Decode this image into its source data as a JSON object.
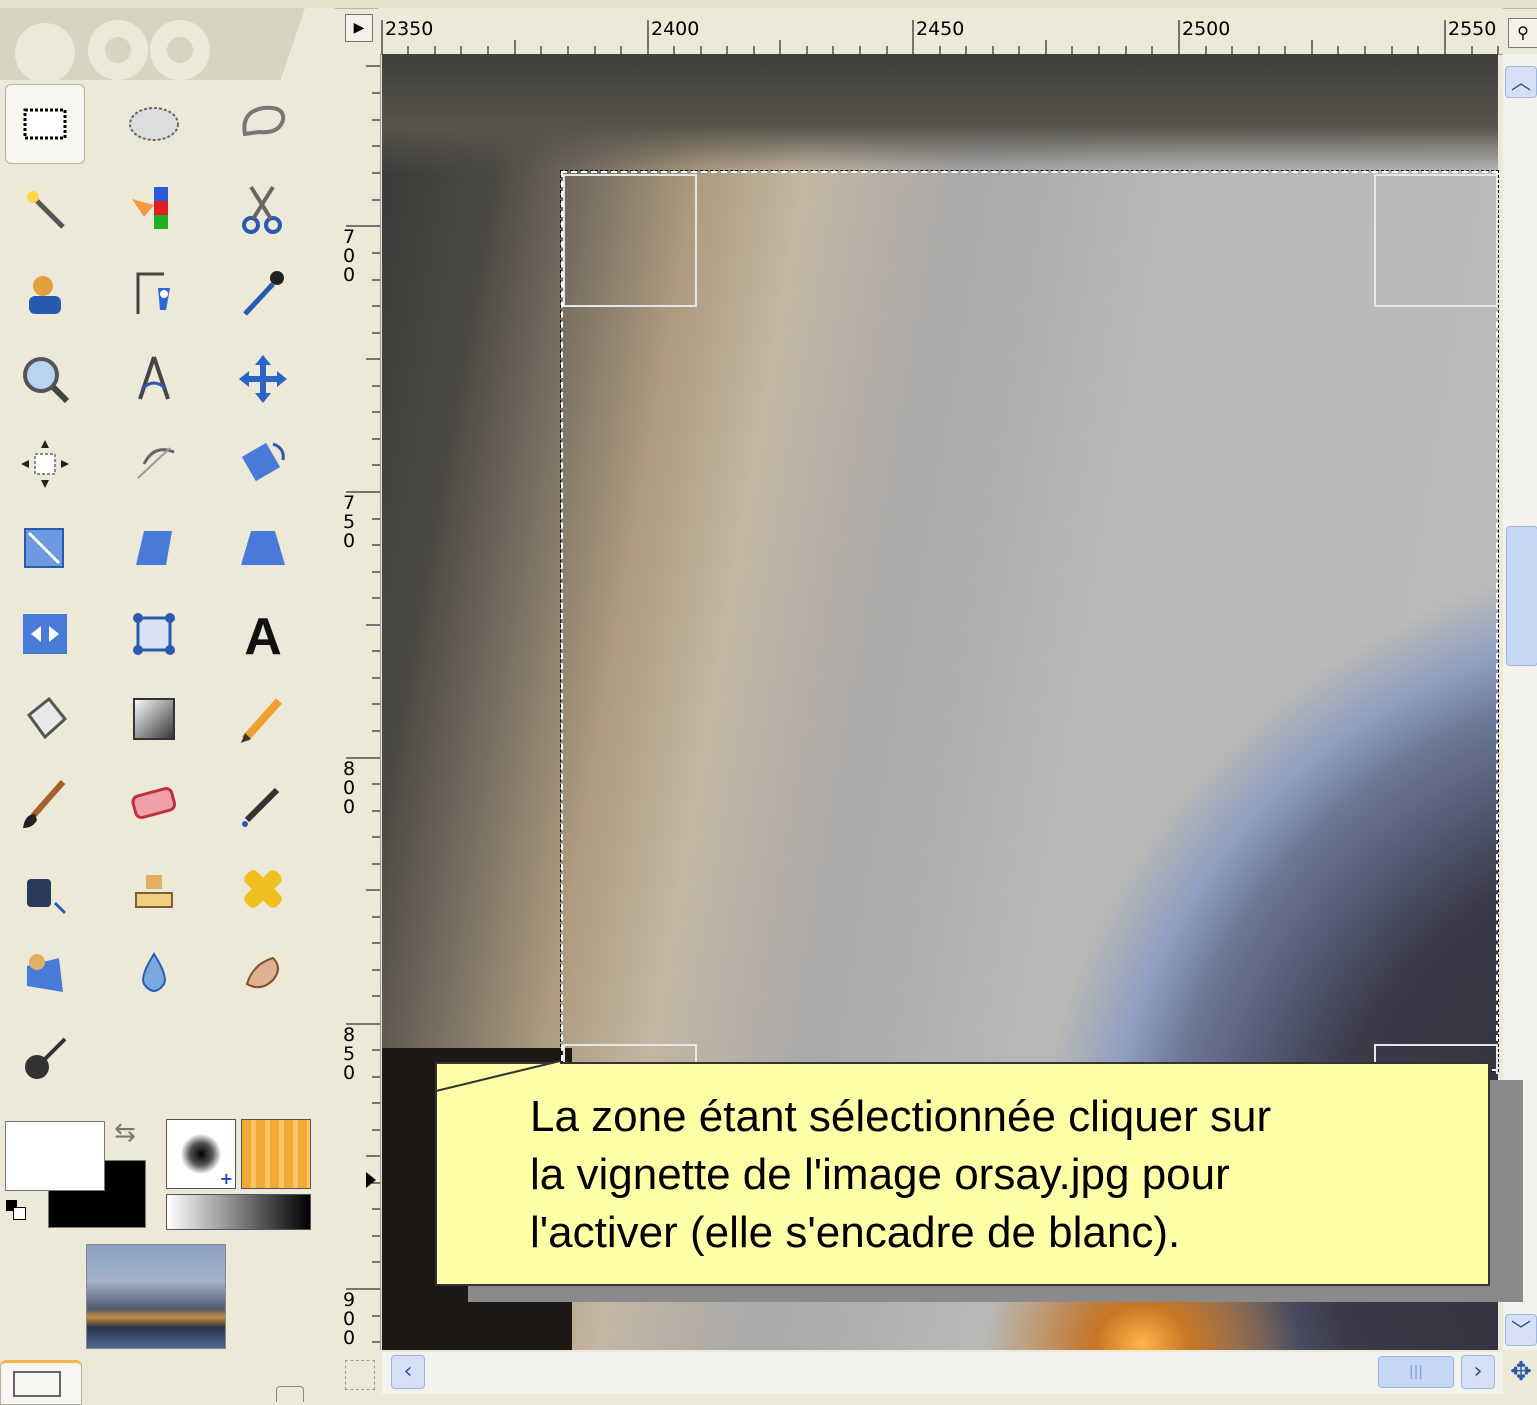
{
  "rulers": {
    "horizontal": [
      "2350",
      "2400",
      "2450",
      "2500",
      "2550"
    ],
    "vertical": [
      "700",
      "750",
      "800",
      "850",
      "900"
    ]
  },
  "toolbox": {
    "tools": [
      {
        "icon": "rect-select-icon",
        "active": true
      },
      {
        "icon": "ellipse-select-icon"
      },
      {
        "icon": "free-select-icon"
      },
      {
        "icon": "fuzzy-select-icon"
      },
      {
        "icon": "select-by-color-icon"
      },
      {
        "icon": "scissors-select-icon"
      },
      {
        "icon": "foreground-select-icon"
      },
      {
        "icon": "paths-icon"
      },
      {
        "icon": "color-picker-icon"
      },
      {
        "icon": "zoom-icon"
      },
      {
        "icon": "measure-icon"
      },
      {
        "icon": "move-icon"
      },
      {
        "icon": "align-icon"
      },
      {
        "icon": "crop-icon"
      },
      {
        "icon": "rotate-icon"
      },
      {
        "icon": "scale-icon"
      },
      {
        "icon": "shear-icon"
      },
      {
        "icon": "perspective-icon"
      },
      {
        "icon": "flip-icon"
      },
      {
        "icon": "cage-icon"
      },
      {
        "icon": "text-icon"
      },
      {
        "icon": "bucket-fill-icon"
      },
      {
        "icon": "blend-icon"
      },
      {
        "icon": "pencil-icon"
      },
      {
        "icon": "paintbrush-icon"
      },
      {
        "icon": "eraser-icon"
      },
      {
        "icon": "airbrush-icon"
      },
      {
        "icon": "ink-icon"
      },
      {
        "icon": "clone-icon"
      },
      {
        "icon": "heal-icon"
      },
      {
        "icon": "perspective-clone-icon"
      },
      {
        "icon": "blur-icon"
      },
      {
        "icon": "smudge-icon"
      },
      {
        "icon": "dodge-burn-icon"
      }
    ],
    "colors": {
      "foreground": "#ffffff",
      "background": "#000000"
    }
  },
  "callout": {
    "line1": "La zone étant sélectionnée cliquer sur",
    "line2": "la vignette de l'image orsay.jpg pour",
    "line3": "l'activer (elle s'encadre de blanc)."
  },
  "accent": "#ffffa8"
}
